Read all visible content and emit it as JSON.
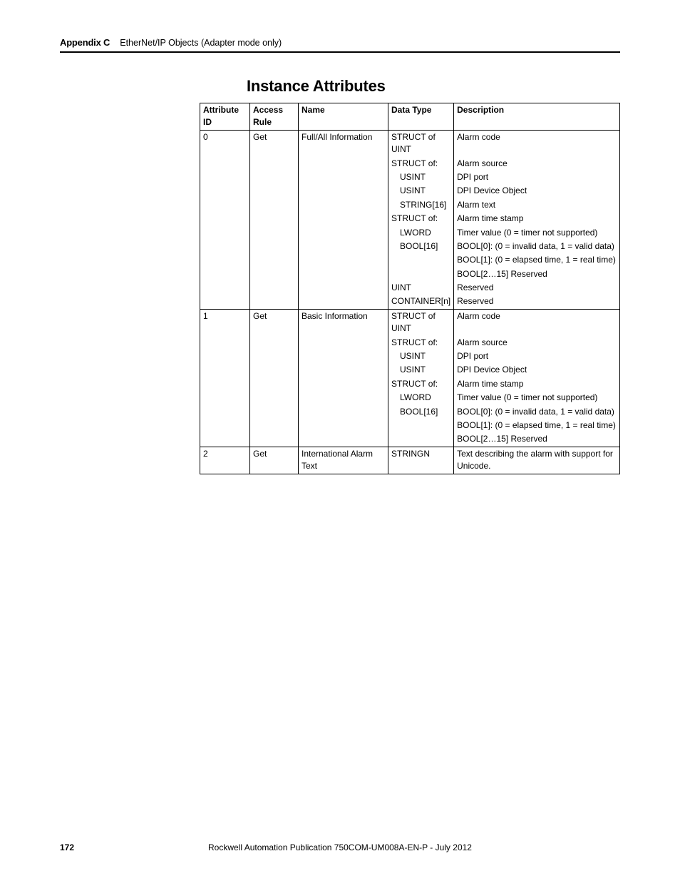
{
  "header": {
    "appendix_label": "Appendix C",
    "chapter_title": "EtherNet/IP Objects (Adapter mode only)"
  },
  "section_title": "Instance Attributes",
  "table": {
    "columns": [
      "Attribute ID",
      "Access Rule",
      "Name",
      "Data Type",
      "Description"
    ],
    "groups": [
      {
        "attribute_id": "0",
        "access_rule": "Get",
        "name": "Full/All Information",
        "rows": [
          {
            "data_type": "STRUCT of UINT",
            "indent": 0,
            "description": "Alarm code"
          },
          {
            "data_type": "STRUCT of:",
            "indent": 0,
            "description": "Alarm source"
          },
          {
            "data_type": "USINT",
            "indent": 1,
            "description": "DPI port"
          },
          {
            "data_type": "USINT",
            "indent": 1,
            "description": "DPI Device Object"
          },
          {
            "data_type": "STRING[16]",
            "indent": 1,
            "description": "Alarm text"
          },
          {
            "data_type": "STRUCT of:",
            "indent": 0,
            "description": "Alarm time stamp"
          },
          {
            "data_type": "LWORD",
            "indent": 1,
            "description": "Timer value (0 = timer not supported)"
          },
          {
            "data_type": "BOOL[16]",
            "indent": 1,
            "description": "BOOL[0]: (0 = invalid data, 1 = valid data)"
          },
          {
            "data_type": "",
            "indent": 0,
            "description": "BOOL[1]: (0 = elapsed time, 1 = real time)"
          },
          {
            "data_type": "",
            "indent": 0,
            "description": "BOOL[2…15] Reserved"
          },
          {
            "data_type": "UINT",
            "indent": 0,
            "description": "Reserved"
          },
          {
            "data_type": "CONTAINER[n]",
            "indent": 0,
            "description": "Reserved"
          }
        ]
      },
      {
        "attribute_id": "1",
        "access_rule": "Get",
        "name": "Basic Information",
        "rows": [
          {
            "data_type": "STRUCT of UINT",
            "indent": 0,
            "description": "Alarm code"
          },
          {
            "data_type": "STRUCT of:",
            "indent": 0,
            "description": "Alarm source"
          },
          {
            "data_type": "USINT",
            "indent": 1,
            "description": "DPI port"
          },
          {
            "data_type": "USINT",
            "indent": 1,
            "description": "DPI Device Object"
          },
          {
            "data_type": "STRUCT of:",
            "indent": 0,
            "description": "Alarm time stamp"
          },
          {
            "data_type": "LWORD",
            "indent": 1,
            "description": "Timer value (0 = timer not supported)"
          },
          {
            "data_type": "BOOL[16]",
            "indent": 1,
            "description": "BOOL[0]: (0 = invalid data, 1 = valid data)"
          },
          {
            "data_type": "",
            "indent": 0,
            "description": "BOOL[1]: (0 = elapsed time, 1 = real time)"
          },
          {
            "data_type": "",
            "indent": 0,
            "description": "BOOL[2…15] Reserved"
          }
        ]
      },
      {
        "attribute_id": "2",
        "access_rule": "Get",
        "name": "International Alarm Text",
        "rows": [
          {
            "data_type": "STRINGN",
            "indent": 0,
            "description": "Text describing the alarm with support for Unicode."
          }
        ]
      }
    ]
  },
  "footer": {
    "page_number": "172",
    "publication": "Rockwell Automation Publication 750COM-UM008A-EN-P - July 2012"
  }
}
